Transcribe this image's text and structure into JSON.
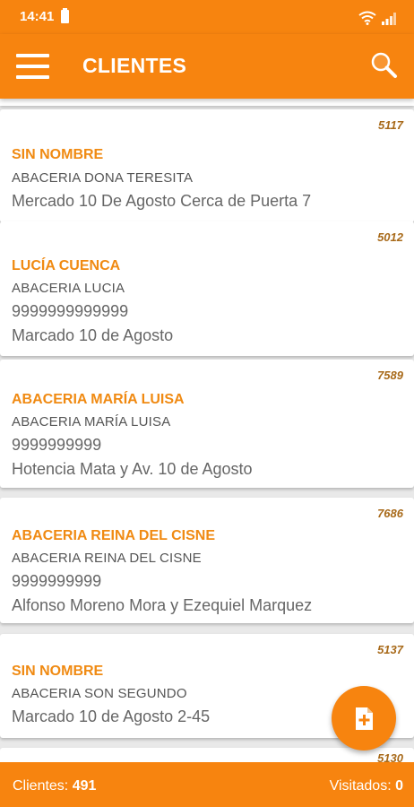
{
  "status_bar": {
    "time": "14:41"
  },
  "app_bar": {
    "title": "CLIENTES"
  },
  "clients": [
    {
      "code": "5117",
      "name": "SIN NOMBRE",
      "business": "ABACERIA DONA TERESITA",
      "phone": "",
      "address": "Mercado 10 De Agosto Cerca de Puerta 7"
    },
    {
      "code": "5012",
      "name": "LUCÍA CUENCA",
      "business": "ABACERIA LUCIA",
      "phone": "9999999999999",
      "address": "Marcado 10 de Agosto"
    },
    {
      "code": "7589",
      "name": "ABACERIA MARÍA LUISA",
      "business": "ABACERIA MARÍA LUISA",
      "phone": "9999999999",
      "address": "Hotencia Mata  y Av. 10 de Agosto"
    },
    {
      "code": "7686",
      "name": "ABACERIA REINA DEL CISNE",
      "business": "ABACERIA REINA DEL CISNE",
      "phone": "9999999999",
      "address": "Alfonso Moreno Mora  y Ezequiel Marquez"
    },
    {
      "code": "5137",
      "name": "SIN NOMBRE",
      "business": "ABACERIA SON SEGUNDO",
      "phone": "",
      "address": "Marcado 10 de Agosto  2-45"
    }
  ],
  "partial_next_code": "5130",
  "footer": {
    "clients_label": "Clientes:",
    "clients_count": "491",
    "visited_label": "Visitados:",
    "visited_count": "0"
  },
  "icons": {
    "menu": "hamburger-icon",
    "search": "search-icon",
    "fab": "add-document-icon"
  },
  "colors": {
    "accent": "#f7840f",
    "name_text": "#f08a12",
    "code_text": "#a86a1a"
  }
}
